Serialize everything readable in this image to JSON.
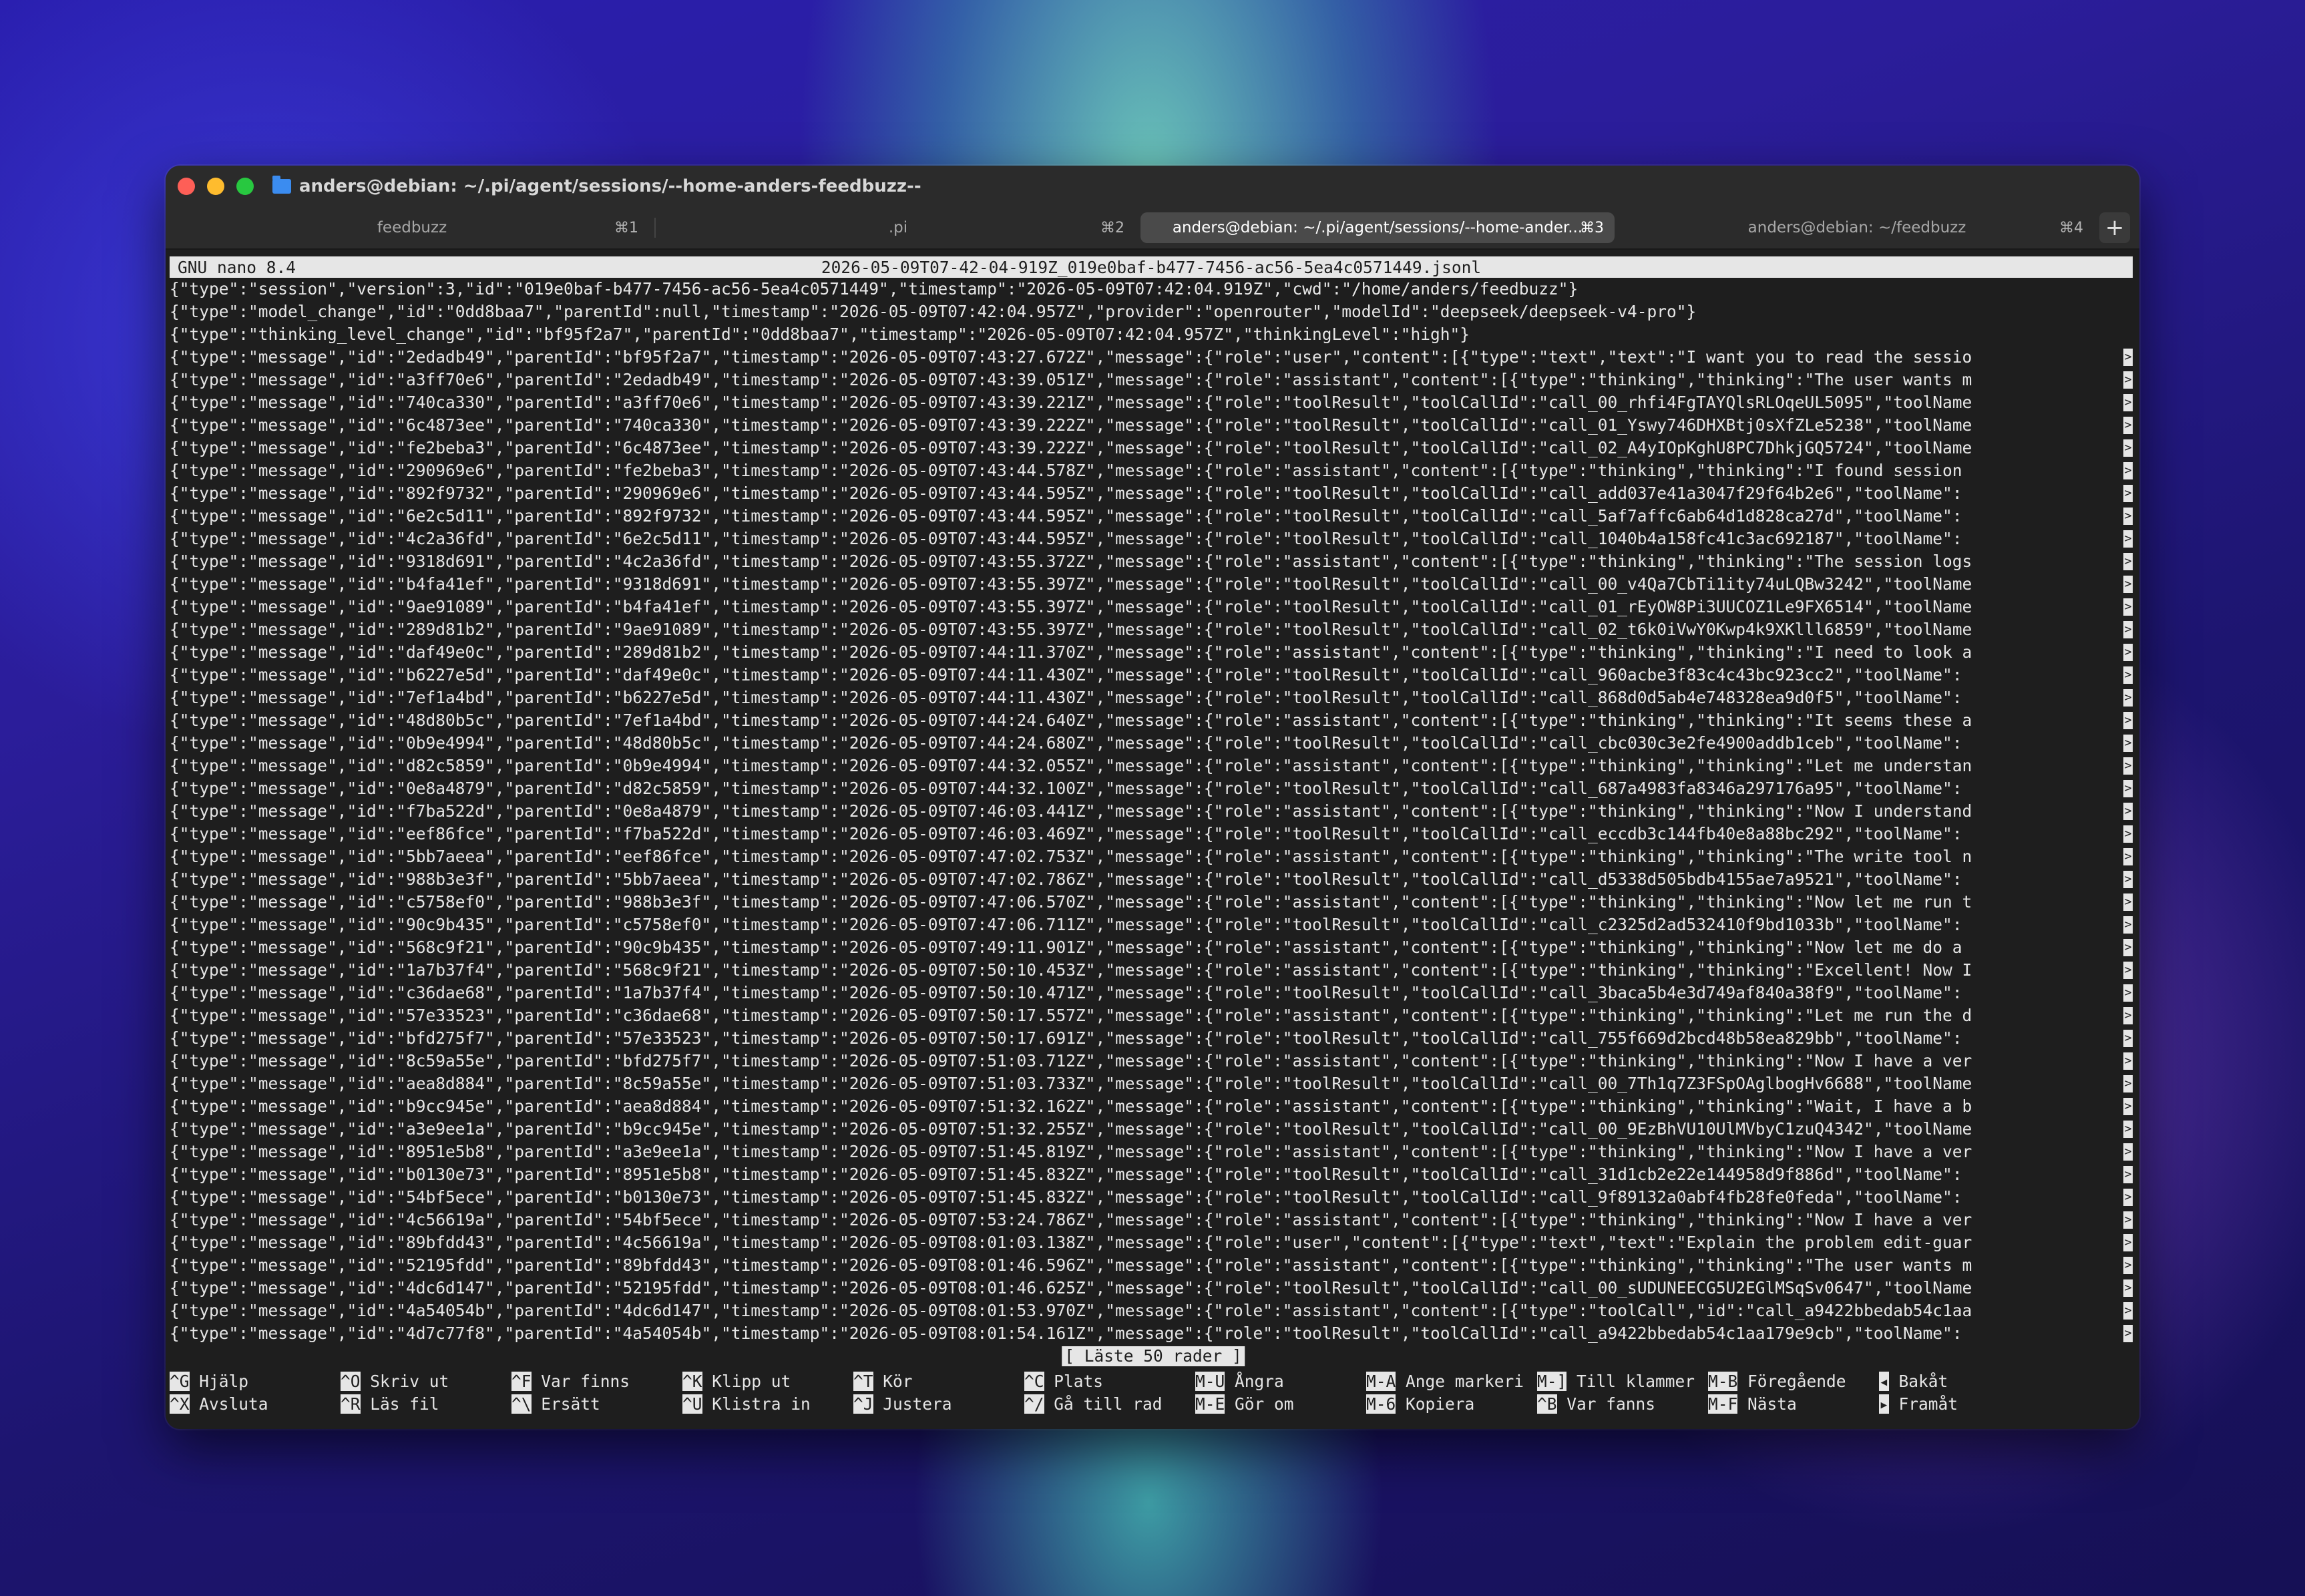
{
  "window": {
    "title": "anders@debian: ~/.pi/agent/sessions/--home-anders-feedbuzz--"
  },
  "tabs": [
    {
      "label": "feedbuzz",
      "shortcut": "⌘1",
      "active": false
    },
    {
      "label": ".pi",
      "shortcut": "⌘2",
      "active": false
    },
    {
      "label": "anders@debian: ~/.pi/agent/sessions/--home-ander...",
      "shortcut": "⌘3",
      "active": true
    },
    {
      "label": "anders@debian: ~/feedbuzz",
      "shortcut": "⌘4",
      "active": false
    }
  ],
  "new_tab": "+",
  "nano": {
    "version": "GNU nano 8.4",
    "filename": "2026-05-09T07-42-04-919Z_019e0baf-b477-7456-ac56-5ea4c0571449.jsonl",
    "status": "[ Läste 50 rader ]",
    "lines": [
      {
        "text": "{\"type\":\"session\",\"version\":3,\"id\":\"019e0baf-b477-7456-ac56-5ea4c0571449\",\"timestamp\":\"2026-05-09T07:42:04.919Z\",\"cwd\":\"/home/anders/feedbuzz\"}",
        "more": false
      },
      {
        "text": "{\"type\":\"model_change\",\"id\":\"0dd8baa7\",\"parentId\":null,\"timestamp\":\"2026-05-09T07:42:04.957Z\",\"provider\":\"openrouter\",\"modelId\":\"deepseek/deepseek-v4-pro\"}",
        "more": false
      },
      {
        "text": "{\"type\":\"thinking_level_change\",\"id\":\"bf95f2a7\",\"parentId\":\"0dd8baa7\",\"timestamp\":\"2026-05-09T07:42:04.957Z\",\"thinkingLevel\":\"high\"}",
        "more": false
      },
      {
        "text": "{\"type\":\"message\",\"id\":\"2edadb49\",\"parentId\":\"bf95f2a7\",\"timestamp\":\"2026-05-09T07:43:27.672Z\",\"message\":{\"role\":\"user\",\"content\":[{\"type\":\"text\",\"text\":\"I want you to read the sessio",
        "more": true
      },
      {
        "text": "{\"type\":\"message\",\"id\":\"a3ff70e6\",\"parentId\":\"2edadb49\",\"timestamp\":\"2026-05-09T07:43:39.051Z\",\"message\":{\"role\":\"assistant\",\"content\":[{\"type\":\"thinking\",\"thinking\":\"The user wants m",
        "more": true
      },
      {
        "text": "{\"type\":\"message\",\"id\":\"740ca330\",\"parentId\":\"a3ff70e6\",\"timestamp\":\"2026-05-09T07:43:39.221Z\",\"message\":{\"role\":\"toolResult\",\"toolCallId\":\"call_00_rhfi4FgTAYQlsRLOqeUL5095\",\"toolName",
        "more": true
      },
      {
        "text": "{\"type\":\"message\",\"id\":\"6c4873ee\",\"parentId\":\"740ca330\",\"timestamp\":\"2026-05-09T07:43:39.222Z\",\"message\":{\"role\":\"toolResult\",\"toolCallId\":\"call_01_Yswy746DHXBtj0sXfZLe5238\",\"toolName",
        "more": true
      },
      {
        "text": "{\"type\":\"message\",\"id\":\"fe2beba3\",\"parentId\":\"6c4873ee\",\"timestamp\":\"2026-05-09T07:43:39.222Z\",\"message\":{\"role\":\"toolResult\",\"toolCallId\":\"call_02_A4yIOpKghU8PC7DhkjGQ5724\",\"toolName",
        "more": true
      },
      {
        "text": "{\"type\":\"message\",\"id\":\"290969e6\",\"parentId\":\"fe2beba3\",\"timestamp\":\"2026-05-09T07:43:44.578Z\",\"message\":{\"role\":\"assistant\",\"content\":[{\"type\":\"thinking\",\"thinking\":\"I found session ",
        "more": true
      },
      {
        "text": "{\"type\":\"message\",\"id\":\"892f9732\",\"parentId\":\"290969e6\",\"timestamp\":\"2026-05-09T07:43:44.595Z\",\"message\":{\"role\":\"toolResult\",\"toolCallId\":\"call_add037e41a3047f29f64b2e6\",\"toolName\":",
        "more": true
      },
      {
        "text": "{\"type\":\"message\",\"id\":\"6e2c5d11\",\"parentId\":\"892f9732\",\"timestamp\":\"2026-05-09T07:43:44.595Z\",\"message\":{\"role\":\"toolResult\",\"toolCallId\":\"call_5af7affc6ab64d1d828ca27d\",\"toolName\":",
        "more": true
      },
      {
        "text": "{\"type\":\"message\",\"id\":\"4c2a36fd\",\"parentId\":\"6e2c5d11\",\"timestamp\":\"2026-05-09T07:43:44.595Z\",\"message\":{\"role\":\"toolResult\",\"toolCallId\":\"call_1040b4a158fc41c3ac692187\",\"toolName\":",
        "more": true
      },
      {
        "text": "{\"type\":\"message\",\"id\":\"9318d691\",\"parentId\":\"4c2a36fd\",\"timestamp\":\"2026-05-09T07:43:55.372Z\",\"message\":{\"role\":\"assistant\",\"content\":[{\"type\":\"thinking\",\"thinking\":\"The session logs",
        "more": true
      },
      {
        "text": "{\"type\":\"message\",\"id\":\"b4fa41ef\",\"parentId\":\"9318d691\",\"timestamp\":\"2026-05-09T07:43:55.397Z\",\"message\":{\"role\":\"toolResult\",\"toolCallId\":\"call_00_v4Qa7CbTi1ity74uLQBw3242\",\"toolName",
        "more": true
      },
      {
        "text": "{\"type\":\"message\",\"id\":\"9ae91089\",\"parentId\":\"b4fa41ef\",\"timestamp\":\"2026-05-09T07:43:55.397Z\",\"message\":{\"role\":\"toolResult\",\"toolCallId\":\"call_01_rEyOW8Pi3UUCOZ1Le9FX6514\",\"toolName",
        "more": true
      },
      {
        "text": "{\"type\":\"message\",\"id\":\"289d81b2\",\"parentId\":\"9ae91089\",\"timestamp\":\"2026-05-09T07:43:55.397Z\",\"message\":{\"role\":\"toolResult\",\"toolCallId\":\"call_02_t6k0iVwY0Kwp4k9XKlll6859\",\"toolName",
        "more": true
      },
      {
        "text": "{\"type\":\"message\",\"id\":\"daf49e0c\",\"parentId\":\"289d81b2\",\"timestamp\":\"2026-05-09T07:44:11.370Z\",\"message\":{\"role\":\"assistant\",\"content\":[{\"type\":\"thinking\",\"thinking\":\"I need to look a",
        "more": true
      },
      {
        "text": "{\"type\":\"message\",\"id\":\"b6227e5d\",\"parentId\":\"daf49e0c\",\"timestamp\":\"2026-05-09T07:44:11.430Z\",\"message\":{\"role\":\"toolResult\",\"toolCallId\":\"call_960acbe3f83c4c43bc923cc2\",\"toolName\":",
        "more": true
      },
      {
        "text": "{\"type\":\"message\",\"id\":\"7ef1a4bd\",\"parentId\":\"b6227e5d\",\"timestamp\":\"2026-05-09T07:44:11.430Z\",\"message\":{\"role\":\"toolResult\",\"toolCallId\":\"call_868d0d5ab4e748328ea9d0f5\",\"toolName\":",
        "more": true
      },
      {
        "text": "{\"type\":\"message\",\"id\":\"48d80b5c\",\"parentId\":\"7ef1a4bd\",\"timestamp\":\"2026-05-09T07:44:24.640Z\",\"message\":{\"role\":\"assistant\",\"content\":[{\"type\":\"thinking\",\"thinking\":\"It seems these a",
        "more": true
      },
      {
        "text": "{\"type\":\"message\",\"id\":\"0b9e4994\",\"parentId\":\"48d80b5c\",\"timestamp\":\"2026-05-09T07:44:24.680Z\",\"message\":{\"role\":\"toolResult\",\"toolCallId\":\"call_cbc030c3e2fe4900addb1ceb\",\"toolName\":",
        "more": true
      },
      {
        "text": "{\"type\":\"message\",\"id\":\"d82c5859\",\"parentId\":\"0b9e4994\",\"timestamp\":\"2026-05-09T07:44:32.055Z\",\"message\":{\"role\":\"assistant\",\"content\":[{\"type\":\"thinking\",\"thinking\":\"Let me understan",
        "more": true
      },
      {
        "text": "{\"type\":\"message\",\"id\":\"0e8a4879\",\"parentId\":\"d82c5859\",\"timestamp\":\"2026-05-09T07:44:32.100Z\",\"message\":{\"role\":\"toolResult\",\"toolCallId\":\"call_687a4983fa8346a297176a95\",\"toolName\":",
        "more": true
      },
      {
        "text": "{\"type\":\"message\",\"id\":\"f7ba522d\",\"parentId\":\"0e8a4879\",\"timestamp\":\"2026-05-09T07:46:03.441Z\",\"message\":{\"role\":\"assistant\",\"content\":[{\"type\":\"thinking\",\"thinking\":\"Now I understand",
        "more": true
      },
      {
        "text": "{\"type\":\"message\",\"id\":\"eef86fce\",\"parentId\":\"f7ba522d\",\"timestamp\":\"2026-05-09T07:46:03.469Z\",\"message\":{\"role\":\"toolResult\",\"toolCallId\":\"call_eccdb3c144fb40e8a88bc292\",\"toolName\":",
        "more": true
      },
      {
        "text": "{\"type\":\"message\",\"id\":\"5bb7aeea\",\"parentId\":\"eef86fce\",\"timestamp\":\"2026-05-09T07:47:02.753Z\",\"message\":{\"role\":\"assistant\",\"content\":[{\"type\":\"thinking\",\"thinking\":\"The write tool n",
        "more": true
      },
      {
        "text": "{\"type\":\"message\",\"id\":\"988b3e3f\",\"parentId\":\"5bb7aeea\",\"timestamp\":\"2026-05-09T07:47:02.786Z\",\"message\":{\"role\":\"toolResult\",\"toolCallId\":\"call_d5338d505bdb4155ae7a9521\",\"toolName\":",
        "more": true
      },
      {
        "text": "{\"type\":\"message\",\"id\":\"c5758ef0\",\"parentId\":\"988b3e3f\",\"timestamp\":\"2026-05-09T07:47:06.570Z\",\"message\":{\"role\":\"assistant\",\"content\":[{\"type\":\"thinking\",\"thinking\":\"Now let me run t",
        "more": true
      },
      {
        "text": "{\"type\":\"message\",\"id\":\"90c9b435\",\"parentId\":\"c5758ef0\",\"timestamp\":\"2026-05-09T07:47:06.711Z\",\"message\":{\"role\":\"toolResult\",\"toolCallId\":\"call_c2325d2ad532410f9bd1033b\",\"toolName\":",
        "more": true
      },
      {
        "text": "{\"type\":\"message\",\"id\":\"568c9f21\",\"parentId\":\"90c9b435\",\"timestamp\":\"2026-05-09T07:49:11.901Z\",\"message\":{\"role\":\"assistant\",\"content\":[{\"type\":\"thinking\",\"thinking\":\"Now let me do a ",
        "more": true
      },
      {
        "text": "{\"type\":\"message\",\"id\":\"1a7b37f4\",\"parentId\":\"568c9f21\",\"timestamp\":\"2026-05-09T07:50:10.453Z\",\"message\":{\"role\":\"assistant\",\"content\":[{\"type\":\"thinking\",\"thinking\":\"Excellent! Now I",
        "more": true
      },
      {
        "text": "{\"type\":\"message\",\"id\":\"c36dae68\",\"parentId\":\"1a7b37f4\",\"timestamp\":\"2026-05-09T07:50:10.471Z\",\"message\":{\"role\":\"toolResult\",\"toolCallId\":\"call_3baca5b4e3d749af840a38f9\",\"toolName\":",
        "more": true
      },
      {
        "text": "{\"type\":\"message\",\"id\":\"57e33523\",\"parentId\":\"c36dae68\",\"timestamp\":\"2026-05-09T07:50:17.557Z\",\"message\":{\"role\":\"assistant\",\"content\":[{\"type\":\"thinking\",\"thinking\":\"Let me run the d",
        "more": true
      },
      {
        "text": "{\"type\":\"message\",\"id\":\"bfd275f7\",\"parentId\":\"57e33523\",\"timestamp\":\"2026-05-09T07:50:17.691Z\",\"message\":{\"role\":\"toolResult\",\"toolCallId\":\"call_755f669d2bcd48b58ea829bb\",\"toolName\":",
        "more": true
      },
      {
        "text": "{\"type\":\"message\",\"id\":\"8c59a55e\",\"parentId\":\"bfd275f7\",\"timestamp\":\"2026-05-09T07:51:03.712Z\",\"message\":{\"role\":\"assistant\",\"content\":[{\"type\":\"thinking\",\"thinking\":\"Now I have a ver",
        "more": true
      },
      {
        "text": "{\"type\":\"message\",\"id\":\"aea8d884\",\"parentId\":\"8c59a55e\",\"timestamp\":\"2026-05-09T07:51:03.733Z\",\"message\":{\"role\":\"toolResult\",\"toolCallId\":\"call_00_7Th1q7Z3FSpOAglbogHv6688\",\"toolName",
        "more": true
      },
      {
        "text": "{\"type\":\"message\",\"id\":\"b9cc945e\",\"parentId\":\"aea8d884\",\"timestamp\":\"2026-05-09T07:51:32.162Z\",\"message\":{\"role\":\"assistant\",\"content\":[{\"type\":\"thinking\",\"thinking\":\"Wait, I have a b",
        "more": true
      },
      {
        "text": "{\"type\":\"message\",\"id\":\"a3e9ee1a\",\"parentId\":\"b9cc945e\",\"timestamp\":\"2026-05-09T07:51:32.255Z\",\"message\":{\"role\":\"toolResult\",\"toolCallId\":\"call_00_9EzBhVU10UlMVbyC1zuQ4342\",\"toolName",
        "more": true
      },
      {
        "text": "{\"type\":\"message\",\"id\":\"8951e5b8\",\"parentId\":\"a3e9ee1a\",\"timestamp\":\"2026-05-09T07:51:45.819Z\",\"message\":{\"role\":\"assistant\",\"content\":[{\"type\":\"thinking\",\"thinking\":\"Now I have a ver",
        "more": true
      },
      {
        "text": "{\"type\":\"message\",\"id\":\"b0130e73\",\"parentId\":\"8951e5b8\",\"timestamp\":\"2026-05-09T07:51:45.832Z\",\"message\":{\"role\":\"toolResult\",\"toolCallId\":\"call_31d1cb2e22e144958d9f886d\",\"toolName\":",
        "more": true
      },
      {
        "text": "{\"type\":\"message\",\"id\":\"54bf5ece\",\"parentId\":\"b0130e73\",\"timestamp\":\"2026-05-09T07:51:45.832Z\",\"message\":{\"role\":\"toolResult\",\"toolCallId\":\"call_9f89132a0abf4fb28fe0feda\",\"toolName\":",
        "more": true
      },
      {
        "text": "{\"type\":\"message\",\"id\":\"4c56619a\",\"parentId\":\"54bf5ece\",\"timestamp\":\"2026-05-09T07:53:24.786Z\",\"message\":{\"role\":\"assistant\",\"content\":[{\"type\":\"thinking\",\"thinking\":\"Now I have a ver",
        "more": true
      },
      {
        "text": "{\"type\":\"message\",\"id\":\"89bfdd43\",\"parentId\":\"4c56619a\",\"timestamp\":\"2026-05-09T08:01:03.138Z\",\"message\":{\"role\":\"user\",\"content\":[{\"type\":\"text\",\"text\":\"Explain the problem edit-guar",
        "more": true
      },
      {
        "text": "{\"type\":\"message\",\"id\":\"52195fdd\",\"parentId\":\"89bfdd43\",\"timestamp\":\"2026-05-09T08:01:46.596Z\",\"message\":{\"role\":\"assistant\",\"content\":[{\"type\":\"thinking\",\"thinking\":\"The user wants m",
        "more": true
      },
      {
        "text": "{\"type\":\"message\",\"id\":\"4dc6d147\",\"parentId\":\"52195fdd\",\"timestamp\":\"2026-05-09T08:01:46.625Z\",\"message\":{\"role\":\"toolResult\",\"toolCallId\":\"call_00_sUDUNEECG5U2EGlMSqSv0647\",\"toolName",
        "more": true
      },
      {
        "text": "{\"type\":\"message\",\"id\":\"4a54054b\",\"parentId\":\"4dc6d147\",\"timestamp\":\"2026-05-09T08:01:53.970Z\",\"message\":{\"role\":\"assistant\",\"content\":[{\"type\":\"toolCall\",\"id\":\"call_a9422bbedab54c1aa",
        "more": true
      },
      {
        "text": "{\"type\":\"message\",\"id\":\"4d7c77f8\",\"parentId\":\"4a54054b\",\"timestamp\":\"2026-05-09T08:01:54.161Z\",\"message\":{\"role\":\"toolResult\",\"toolCallId\":\"call_a9422bbedab54c1aa179e9cb\",\"toolName\":",
        "more": true
      }
    ],
    "shortcuts_row1": [
      {
        "key": "^G",
        "label": "Hjälp"
      },
      {
        "key": "^O",
        "label": "Skriv ut"
      },
      {
        "key": "^F",
        "label": "Var finns"
      },
      {
        "key": "^K",
        "label": "Klipp ut"
      },
      {
        "key": "^T",
        "label": "Kör"
      },
      {
        "key": "^C",
        "label": "Plats"
      },
      {
        "key": "M-U",
        "label": "Ångra"
      },
      {
        "key": "M-A",
        "label": "Ange markeri"
      },
      {
        "key": "M-]",
        "label": "Till klammer"
      },
      {
        "key": "M-B",
        "label": "Föregående"
      },
      {
        "key": "◂",
        "label": "Bakåt"
      }
    ],
    "shortcuts_row2": [
      {
        "key": "^X",
        "label": "Avsluta"
      },
      {
        "key": "^R",
        "label": "Läs fil"
      },
      {
        "key": "^\\",
        "label": "Ersätt"
      },
      {
        "key": "^U",
        "label": "Klistra in"
      },
      {
        "key": "^J",
        "label": "Justera"
      },
      {
        "key": "^/",
        "label": "Gå till rad"
      },
      {
        "key": "M-E",
        "label": "Gör om"
      },
      {
        "key": "M-6",
        "label": "Kopiera"
      },
      {
        "key": "^B",
        "label": "Var fanns"
      },
      {
        "key": "M-F",
        "label": "Nästa"
      },
      {
        "key": "▸",
        "label": "Framåt"
      }
    ]
  }
}
